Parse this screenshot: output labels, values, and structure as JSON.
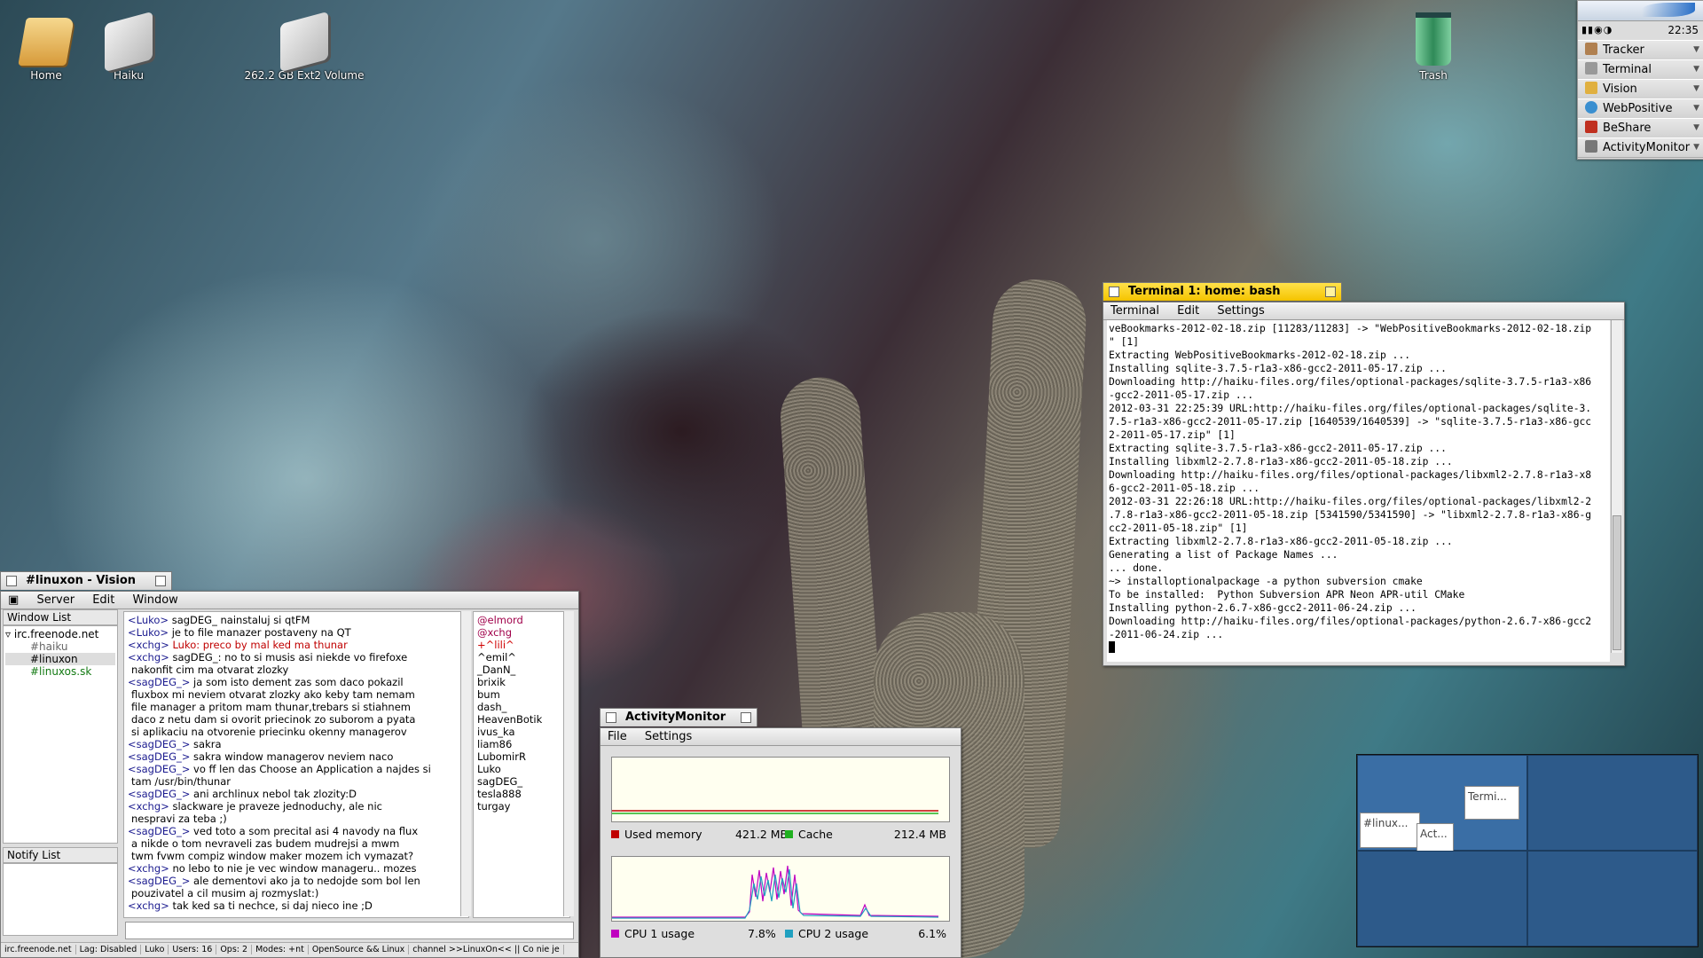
{
  "desktop": {
    "icons": [
      {
        "label": "Home",
        "icon": "home-folder-icon"
      },
      {
        "label": "Haiku",
        "icon": "drive-icon"
      },
      {
        "label": "262.2 GB Ext2 Volume",
        "icon": "drive-icon"
      },
      {
        "label": "Trash",
        "icon": "trash-icon"
      }
    ]
  },
  "deskbar": {
    "clock": "22:35",
    "items": [
      {
        "label": "Tracker",
        "icon": "tracker-icon"
      },
      {
        "label": "Terminal",
        "icon": "terminal-icon"
      },
      {
        "label": "Vision",
        "icon": "vision-icon"
      },
      {
        "label": "WebPositive",
        "icon": "globe-icon"
      },
      {
        "label": "BeShare",
        "icon": "beshare-icon"
      },
      {
        "label": "ActivityMonitor",
        "icon": "activity-monitor-icon"
      }
    ]
  },
  "terminal": {
    "title": "Terminal 1: home: bash",
    "menu": [
      "Terminal",
      "Edit",
      "Settings"
    ],
    "lines": [
      "veBookmarks-2012-02-18.zip [11283/11283] -> \"WebPositiveBookmarks-2012-02-18.zip",
      "\" [1]",
      "Extracting WebPositiveBookmarks-2012-02-18.zip ...",
      "Installing sqlite-3.7.5-r1a3-x86-gcc2-2011-05-17.zip ...",
      "Downloading http://haiku-files.org/files/optional-packages/sqlite-3.7.5-r1a3-x86",
      "-gcc2-2011-05-17.zip ...",
      "2012-03-31 22:25:39 URL:http://haiku-files.org/files/optional-packages/sqlite-3.",
      "7.5-r1a3-x86-gcc2-2011-05-17.zip [1640539/1640539] -> \"sqlite-3.7.5-r1a3-x86-gcc",
      "2-2011-05-17.zip\" [1]",
      "Extracting sqlite-3.7.5-r1a3-x86-gcc2-2011-05-17.zip ...",
      "Installing libxml2-2.7.8-r1a3-x86-gcc2-2011-05-18.zip ...",
      "Downloading http://haiku-files.org/files/optional-packages/libxml2-2.7.8-r1a3-x8",
      "6-gcc2-2011-05-18.zip ...",
      "2012-03-31 22:26:18 URL:http://haiku-files.org/files/optional-packages/libxml2-2",
      ".7.8-r1a3-x86-gcc2-2011-05-18.zip [5341590/5341590] -> \"libxml2-2.7.8-r1a3-x86-g",
      "cc2-2011-05-18.zip\" [1]",
      "Extracting libxml2-2.7.8-r1a3-x86-gcc2-2011-05-18.zip ...",
      "Generating a list of Package Names ...",
      "... done.",
      "~> installoptionalpackage -a python subversion cmake",
      "To be installed:  Python Subversion APR Neon APR-util CMake",
      "Installing python-2.6.7-x86-gcc2-2011-06-24.zip ...",
      "Downloading http://haiku-files.org/files/optional-packages/python-2.6.7-x86-gcc2",
      "-2011-06-24.zip ..."
    ]
  },
  "vision": {
    "title": "#linuxon - Vision",
    "menu": [
      "Server",
      "Edit",
      "Window"
    ],
    "window_list_label": "Window List",
    "notify_list_label": "Notify List",
    "tree": {
      "server": "irc.freenode.net",
      "channels": [
        "#haiku",
        "#linuxon",
        "#linuxos.sk"
      ]
    },
    "messages": [
      {
        "nick": "<Luko>",
        "text": " sagDEG_ nainstaluj si qtFM",
        "hl": false
      },
      {
        "nick": "<Luko>",
        "text": " je to file manazer postaveny na QT",
        "hl": false
      },
      {
        "nick": "<xchg>",
        "text": " Luko: preco  by mal ked ma thunar",
        "hl": true
      },
      {
        "nick": "<xchg>",
        "text": " sagDEG_: no to si musis asi niekde vo firefoxe",
        "hl": false
      },
      {
        "nick": "",
        "text": " nakonfit cim ma otvarat zlozky",
        "hl": false
      },
      {
        "nick": "<sagDEG_>",
        "text": " ja som isto dement zas som daco pokazil",
        "hl": false
      },
      {
        "nick": "",
        "text": " fluxbox mi neviem otvarat zlozky ako keby tam nemam",
        "hl": false
      },
      {
        "nick": "",
        "text": " file manager a pritom mam thunar,trebars si stiahnem",
        "hl": false
      },
      {
        "nick": "",
        "text": " daco z netu dam si ovorit priecinok zo suborom a pyata",
        "hl": false
      },
      {
        "nick": "",
        "text": " si aplikaciu na otvorenie priecinku okenny managerov",
        "hl": false
      },
      {
        "nick": "<sagDEG_>",
        "text": " sakra",
        "hl": false
      },
      {
        "nick": "<sagDEG_>",
        "text": " sakra window managerov neviem naco",
        "hl": false
      },
      {
        "nick": "<sagDEG_>",
        "text": " vo ff len das Choose an Application a najdes si",
        "hl": false
      },
      {
        "nick": "",
        "text": " tam /usr/bin/thunar",
        "hl": false
      },
      {
        "nick": "<sagDEG_>",
        "text": " ani archlinux nebol tak zlozity:D",
        "hl": false
      },
      {
        "nick": "<xchg>",
        "text": " slackware je praveze jednoduchy, ale nic",
        "hl": false
      },
      {
        "nick": "",
        "text": " nespravi za teba ;)",
        "hl": false
      },
      {
        "nick": "<sagDEG_>",
        "text": " ved toto a som precital asi 4 navody na flux",
        "hl": false
      },
      {
        "nick": "",
        "text": " a nikde o tom nevraveli zas budem mudrejsi a mwm",
        "hl": false
      },
      {
        "nick": "",
        "text": " twm fvwm compiz window maker mozem ich vymazat?",
        "hl": false
      },
      {
        "nick": "<xchg>",
        "text": " no lebo to nie je vec window manageru.. mozes",
        "hl": false
      },
      {
        "nick": "<sagDEG_>",
        "text": " ale dementovi ako ja to nedojde som bol len",
        "hl": false
      },
      {
        "nick": "",
        "text": " pouzivatel  a cil musim aj rozmyslat:)",
        "hl": false
      },
      {
        "nick": "<xchg>",
        "text": " tak ked sa ti nechce, si daj nieco ine ;D",
        "hl": false
      }
    ],
    "users": [
      {
        "name": "@elmord",
        "color": "#a0004a"
      },
      {
        "name": "@xchg",
        "color": "#a0004a"
      },
      {
        "name": "+^lili^",
        "color": "#d00000"
      },
      {
        "name": "^emil^",
        "color": "#000"
      },
      {
        "name": "_DanN_",
        "color": "#000"
      },
      {
        "name": "brixik",
        "color": "#000"
      },
      {
        "name": "bum",
        "color": "#000"
      },
      {
        "name": "dash_",
        "color": "#000"
      },
      {
        "name": "HeavenBotik",
        "color": "#000"
      },
      {
        "name": "ivus_ka",
        "color": "#000"
      },
      {
        "name": "liam86",
        "color": "#000"
      },
      {
        "name": "LubomirR",
        "color": "#000"
      },
      {
        "name": "Luko",
        "color": "#000"
      },
      {
        "name": "sagDEG_",
        "color": "#000"
      },
      {
        "name": "tesla888",
        "color": "#000"
      },
      {
        "name": "turgay",
        "color": "#000"
      }
    ],
    "status": [
      "irc.freenode.net",
      "Lag: Disabled",
      "Luko",
      "Users: 16",
      "Ops: 2",
      "Modes: +nt",
      "OpenSource && Linux",
      "channel >>LinuxOn<< || Co nie je"
    ]
  },
  "activity_monitor": {
    "title": "ActivityMonitor",
    "menu": [
      "File",
      "Settings"
    ],
    "memory": {
      "used_label": "Used memory",
      "used_value": "421.2 MB",
      "used_color": "#c00000",
      "cache_label": "Cache",
      "cache_value": "212.4 MB",
      "cache_color": "#20b020"
    },
    "cpu": {
      "cpu1_label": "CPU 1 usage",
      "cpu1_value": "7.8%",
      "cpu1_color": "#c000c0",
      "cpu2_label": "CPU 2 usage",
      "cpu2_value": "6.1%",
      "cpu2_color": "#20a0c0"
    }
  },
  "workspaces": {
    "windows": [
      "Termi...",
      "#linux...",
      "Act..."
    ]
  }
}
